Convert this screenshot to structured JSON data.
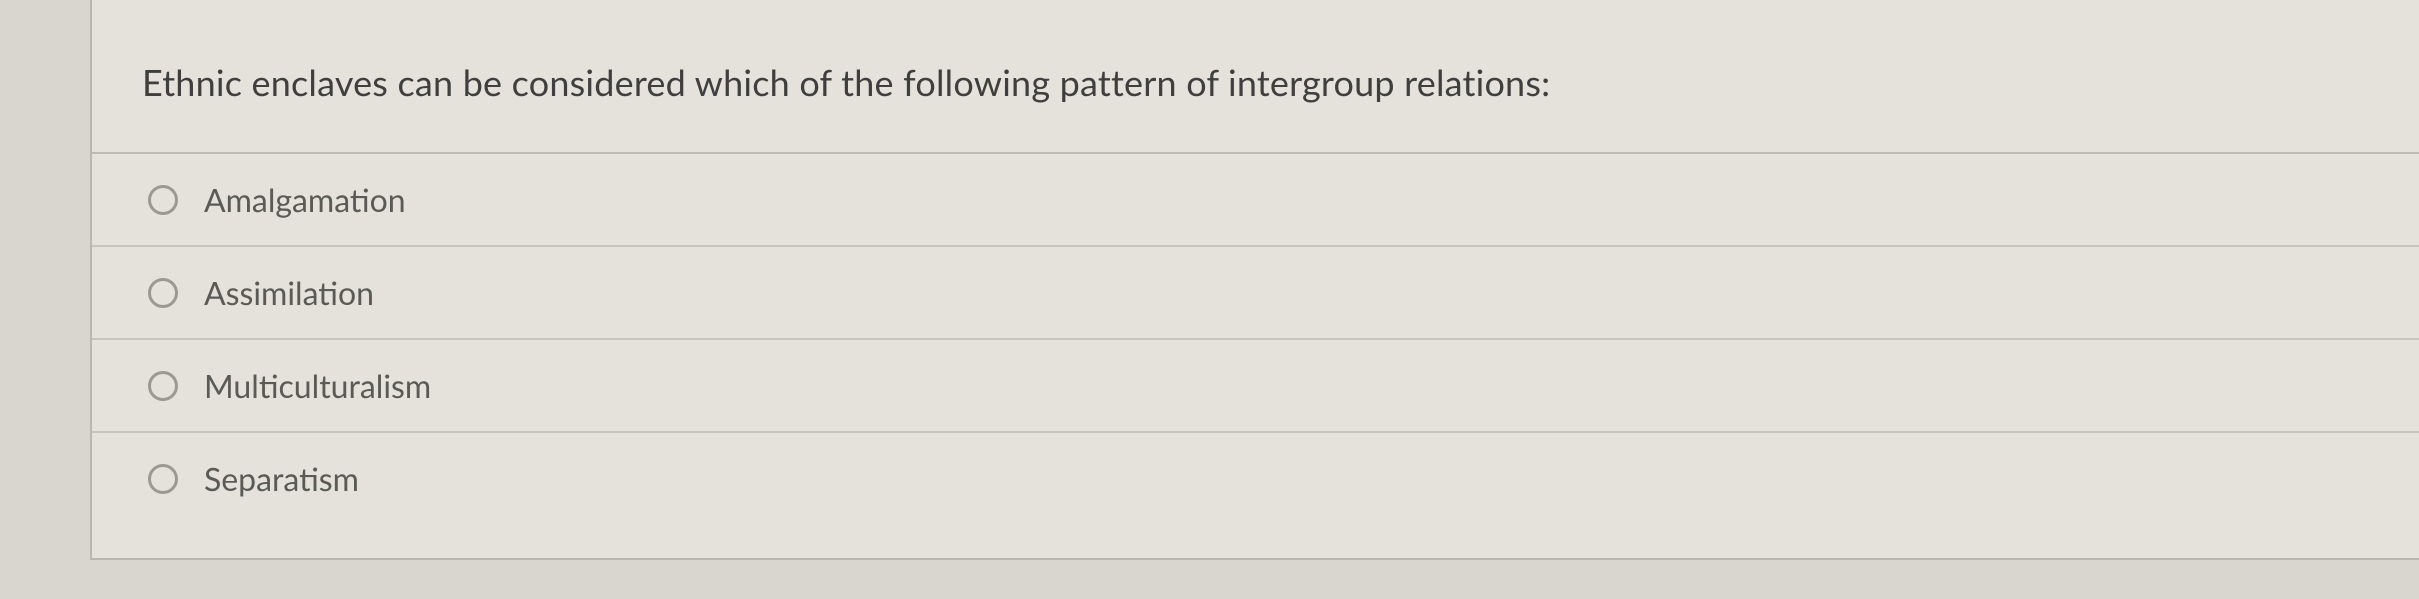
{
  "question": {
    "prompt": "Ethnic enclaves can be considered which of the following pattern of intergroup relations:"
  },
  "options": [
    {
      "label": "Amalgamation"
    },
    {
      "label": "Assimilation"
    },
    {
      "label": "Multiculturalism"
    },
    {
      "label": "Separatism"
    }
  ]
}
